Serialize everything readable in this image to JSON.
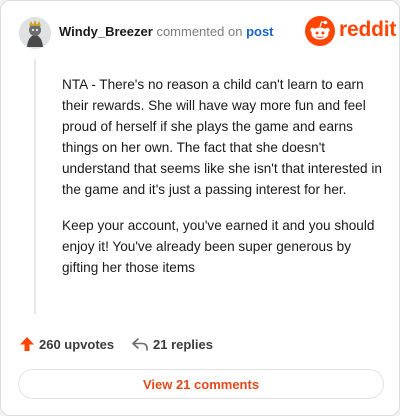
{
  "comment": {
    "username": "Windy_Breezer",
    "action_text": "commented on",
    "post_link": "post",
    "paragraphs": [
      "NTA - There's no reason a child can't learn to earn their rewards. She will have way more fun and feel proud of herself if she plays the game and earns things on her own. The fact that she doesn't understand that seems like she isn't that interested in the game and it's just a passing interest for her.",
      "Keep your account, you've earned it and you should enjoy it! You've already been super generous by gifting her those items"
    ]
  },
  "brand": {
    "name": "reddit",
    "color": "#ff4500"
  },
  "actions": {
    "upvotes": "260 upvotes",
    "replies": "21 replies"
  },
  "view_all": {
    "label": "View 21 comments"
  },
  "colors": {
    "accent": "#ff4500",
    "link": "#1a63c9",
    "button_text": "#e24a1c"
  },
  "icons": [
    "avatar",
    "reddit-logo-icon",
    "upvote-arrow-icon",
    "reply-icon"
  ]
}
